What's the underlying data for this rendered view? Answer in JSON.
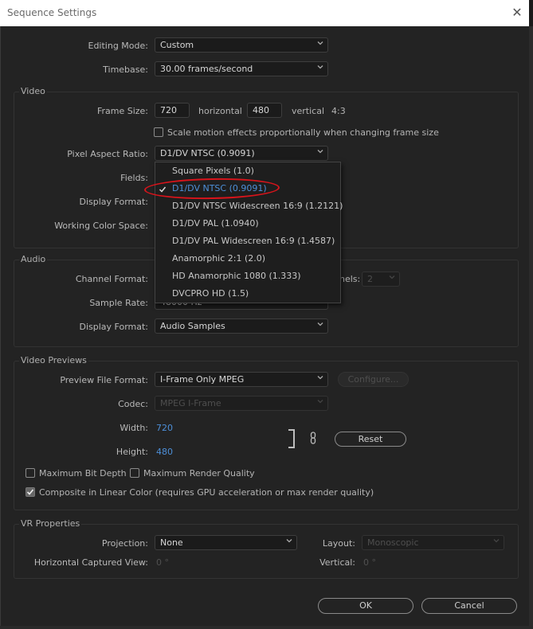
{
  "window": {
    "title": "Sequence Settings"
  },
  "general": {
    "editing_mode_label": "Editing Mode:",
    "editing_mode_value": "Custom",
    "timebase_label": "Timebase:",
    "timebase_value": "30.00  frames/second"
  },
  "video": {
    "title": "Video",
    "frame_size_label": "Frame Size:",
    "width": "720",
    "horizontal_label": "horizontal",
    "height": "480",
    "vertical_label": "vertical",
    "aspect": "4:3",
    "scale_motion_label": "Scale motion effects proportionally when changing frame size",
    "scale_motion_checked": false,
    "par_label": "Pixel Aspect Ratio:",
    "par_value": "D1/DV NTSC (0.9091)",
    "fields_label": "Fields:",
    "display_format_label": "Display Format:",
    "working_color_space_label": "Working Color Space:"
  },
  "par_menu": {
    "items": [
      "Square Pixels (1.0)",
      "D1/DV NTSC (0.9091)",
      "D1/DV NTSC Widescreen 16:9 (1.2121)",
      "D1/DV PAL (1.0940)",
      "D1/DV PAL Widescreen 16:9 (1.4587)",
      "Anamorphic 2:1 (2.0)",
      "HD Anamorphic 1080 (1.333)",
      "DVCPRO HD (1.5)"
    ],
    "selected": "D1/DV NTSC (0.9091)",
    "highlight_color": "#d8141b"
  },
  "audio": {
    "title": "Audio",
    "channel_format_label": "Channel Format:",
    "channels_label_partial": "nels:",
    "channels_value": "2",
    "sample_rate_label": "Sample Rate:",
    "sample_rate_value_partial": "48000 Hz",
    "display_format_label": "Display Format:",
    "display_format_value": "Audio Samples"
  },
  "previews": {
    "title": "Video Previews",
    "file_format_label": "Preview File Format:",
    "file_format_value": "I-Frame Only MPEG",
    "configure_label": "Configure...",
    "codec_label": "Codec:",
    "codec_value": "MPEG I-Frame",
    "width_label": "Width:",
    "width_value": "720",
    "height_label": "Height:",
    "height_value": "480",
    "reset_label": "Reset",
    "max_bit_depth_label": "Maximum Bit Depth",
    "max_bit_depth_checked": false,
    "max_render_quality_label": "Maximum Render Quality",
    "max_render_quality_checked": false,
    "composite_label": "Composite in Linear Color (requires GPU acceleration or max render quality)",
    "composite_checked": true
  },
  "vr": {
    "title": "VR Properties",
    "projection_label": "Projection:",
    "projection_value": "None",
    "layout_label": "Layout:",
    "layout_value": "Monoscopic",
    "h_view_label": "Horizontal Captured View:",
    "h_view_value": "0 °",
    "vertical_label": "Vertical:",
    "vertical_value": "0 °"
  },
  "footer": {
    "ok_label": "OK",
    "cancel_label": "Cancel"
  },
  "colors": {
    "accent_blue": "#4d8fd8",
    "dialog_bg": "#232323"
  }
}
